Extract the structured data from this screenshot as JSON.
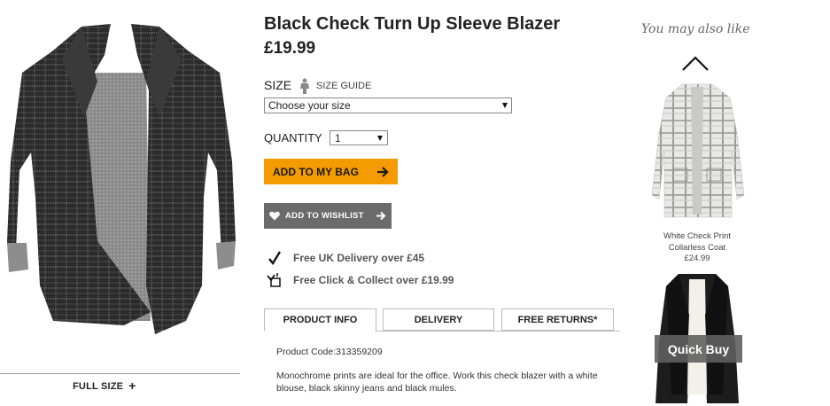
{
  "product": {
    "title": "Black Check Turn Up Sleeve Blazer",
    "price": "£19.99",
    "full_size_label": "FULL SIZE",
    "full_size_plus": "+"
  },
  "size": {
    "label": "SIZE",
    "guide_label": "SIZE GUIDE",
    "selected": "Choose your size"
  },
  "quantity": {
    "label": "QUANTITY",
    "selected": "1"
  },
  "buttons": {
    "add_to_bag": "ADD TO MY BAG",
    "add_to_wishlist": "ADD TO WISHLIST"
  },
  "info": {
    "delivery": "Free UK Delivery over £45",
    "click_collect": "Free Click & Collect over £19.99"
  },
  "tabs": [
    {
      "label": "PRODUCT INFO",
      "active": true
    },
    {
      "label": "DELIVERY",
      "active": false
    },
    {
      "label": "FREE RETURNS*",
      "active": false
    }
  ],
  "product_info": {
    "code": "Product Code:313359209",
    "description": "Monochrome prints are ideal for the office. Work this check blazer with a white blouse, black skinny jeans and black mules."
  },
  "recommendations": {
    "heading": "You may also like",
    "items": [
      {
        "name": "White Check Print Collarless Coat",
        "price": "£24.99"
      },
      {
        "quick_buy_label": "Quick Buy"
      }
    ]
  },
  "colors": {
    "bag_button": "#f39b00",
    "wishlist_button": "#6b6b6b"
  },
  "icons": [
    "size-guide-person-icon",
    "arrow-right-icon",
    "heart-icon",
    "checkmark-icon",
    "click-collect-icon",
    "chevron-up-icon",
    "dropdown-arrow-icon"
  ]
}
